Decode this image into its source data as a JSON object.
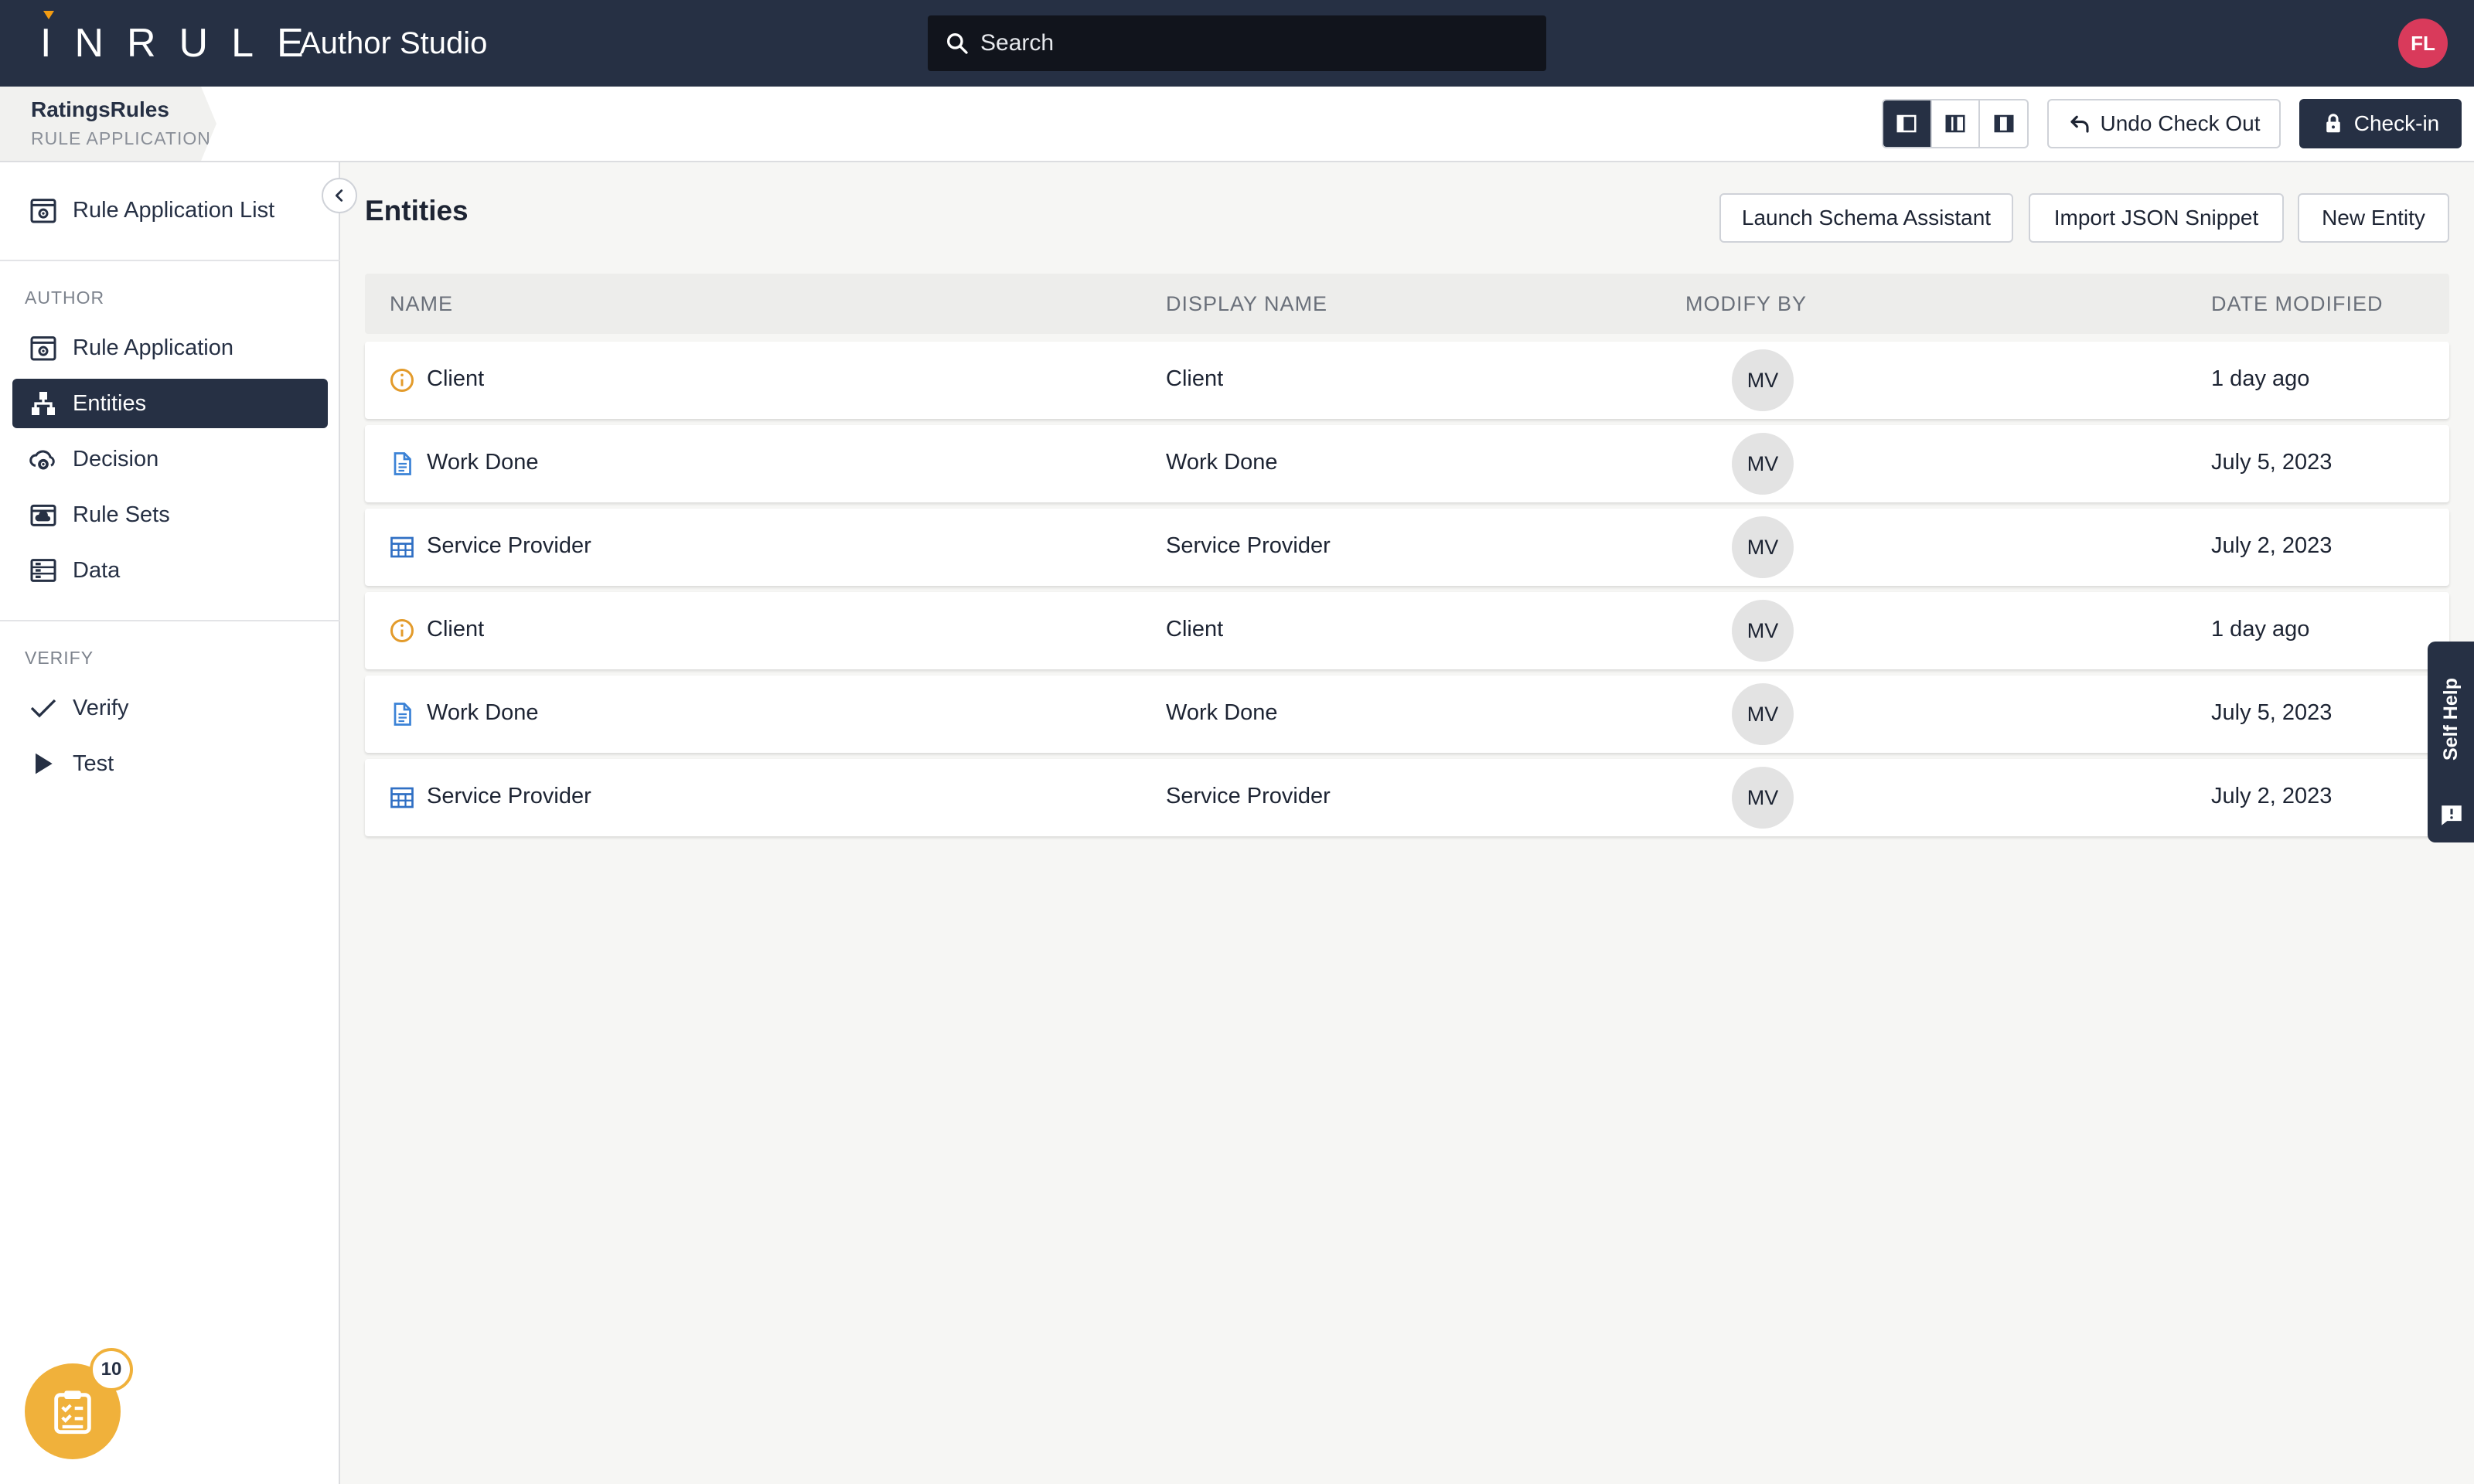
{
  "header": {
    "logo": "INRULE",
    "app_title": "Author Studio",
    "search_placeholder": "Search",
    "user_initials": "FL",
    "colors": {
      "topbar": "#263044",
      "logo_accent": "#f39c12",
      "avatar": "#d93a5b"
    }
  },
  "breadcrumb": {
    "title": "RatingsRules",
    "subtitle": "RULE APPLICATION"
  },
  "toolbar": {
    "view_modes": [
      "layout-left-panel-icon",
      "layout-columns-icon",
      "layout-split-icon"
    ],
    "active_view": 0,
    "undo_checkout_label": "Undo Check Out",
    "checkin_label": "Check-in"
  },
  "sidebar": {
    "top_item": "Rule Application List",
    "author_label": "AUTHOR",
    "author_items": [
      {
        "label": "Rule Application",
        "icon": "gear-document-icon"
      },
      {
        "label": "Entities",
        "icon": "hierarchy-icon",
        "active": true
      },
      {
        "label": "Decision",
        "icon": "cloud-gear-icon"
      },
      {
        "label": "Rule Sets",
        "icon": "folder-cloud-icon"
      },
      {
        "label": "Data",
        "icon": "data-grid-icon"
      }
    ],
    "verify_label": "VERIFY",
    "verify_items": [
      {
        "label": "Verify",
        "icon": "check-icon"
      },
      {
        "label": "Test",
        "icon": "play-icon"
      }
    ],
    "task_count": "10"
  },
  "main": {
    "title": "Entities",
    "actions": [
      "Launch Schema Assistant",
      "Import JSON Snippet",
      "New Entity"
    ],
    "columns": [
      "NAME",
      "DISPLAY NAME",
      "MODIFY BY",
      "DATE MODIFIED"
    ],
    "rows": [
      {
        "icon": "info-circle-icon",
        "name": "Client",
        "display_name": "Client",
        "modify_by": "MV",
        "date": "1 day ago"
      },
      {
        "icon": "document-icon",
        "name": "Work Done",
        "display_name": "Work Done",
        "modify_by": "MV",
        "date": "July 5, 2023"
      },
      {
        "icon": "table-grid-icon",
        "name": "Service Provider",
        "display_name": "Service Provider",
        "modify_by": "MV",
        "date": "July 2, 2023"
      },
      {
        "icon": "info-circle-icon",
        "name": "Client",
        "display_name": "Client",
        "modify_by": "MV",
        "date": "1 day ago"
      },
      {
        "icon": "document-icon",
        "name": "Work Done",
        "display_name": "Work Done",
        "modify_by": "MV",
        "date": "July 5, 2023"
      },
      {
        "icon": "table-grid-icon",
        "name": "Service Provider",
        "display_name": "Service Provider",
        "modify_by": "MV",
        "date": "July 2, 2023"
      }
    ]
  },
  "self_help": {
    "label": "Self Help"
  }
}
